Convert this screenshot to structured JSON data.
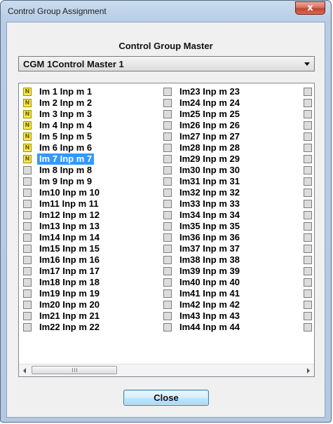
{
  "window": {
    "title": "Control Group Assignment",
    "close_glyph": "x"
  },
  "group_label": "Control Group Master",
  "combo": {
    "selected": "CGM 1Control Master 1"
  },
  "list": {
    "items": [
      {
        "label": "Im 1 Inp m  1",
        "checked": true,
        "selected": false
      },
      {
        "label": "Im 2 Inp m  2",
        "checked": true,
        "selected": false
      },
      {
        "label": "Im 3 Inp m  3",
        "checked": true,
        "selected": false
      },
      {
        "label": "Im 4 Inp m  4",
        "checked": true,
        "selected": false
      },
      {
        "label": "Im 5 Inp m  5",
        "checked": true,
        "selected": false
      },
      {
        "label": "Im 6 Inp m  6",
        "checked": true,
        "selected": false
      },
      {
        "label": "Im 7 Inp m  7",
        "checked": true,
        "selected": true
      },
      {
        "label": "Im 8 Inp m  8",
        "checked": false,
        "selected": false
      },
      {
        "label": "Im 9 Inp m  9",
        "checked": false,
        "selected": false
      },
      {
        "label": "Im10 Inp m 10",
        "checked": false,
        "selected": false
      },
      {
        "label": "Im11 Inp m 11",
        "checked": false,
        "selected": false
      },
      {
        "label": "Im12 Inp m 12",
        "checked": false,
        "selected": false
      },
      {
        "label": "Im13 Inp m 13",
        "checked": false,
        "selected": false
      },
      {
        "label": "Im14 Inp m 14",
        "checked": false,
        "selected": false
      },
      {
        "label": "Im15 Inp m 15",
        "checked": false,
        "selected": false
      },
      {
        "label": "Im16 Inp m 16",
        "checked": false,
        "selected": false
      },
      {
        "label": "Im17 Inp m 17",
        "checked": false,
        "selected": false
      },
      {
        "label": "Im18 Inp m 18",
        "checked": false,
        "selected": false
      },
      {
        "label": "Im19 Inp m 19",
        "checked": false,
        "selected": false
      },
      {
        "label": "Im20 Inp m 20",
        "checked": false,
        "selected": false
      },
      {
        "label": "Im21 Inp m 21",
        "checked": false,
        "selected": false
      },
      {
        "label": "Im22 Inp m 22",
        "checked": false,
        "selected": false
      },
      {
        "label": "Im23 Inp m 23",
        "checked": false,
        "selected": false
      },
      {
        "label": "Im24 Inp m 24",
        "checked": false,
        "selected": false
      },
      {
        "label": "Im25 Inp m 25",
        "checked": false,
        "selected": false
      },
      {
        "label": "Im26 Inp m 26",
        "checked": false,
        "selected": false
      },
      {
        "label": "Im27 Inp m 27",
        "checked": false,
        "selected": false
      },
      {
        "label": "Im28 Inp m 28",
        "checked": false,
        "selected": false
      },
      {
        "label": "Im29 Inp m 29",
        "checked": false,
        "selected": false
      },
      {
        "label": "Im30 Inp m 30",
        "checked": false,
        "selected": false
      },
      {
        "label": "Im31 Inp m 31",
        "checked": false,
        "selected": false
      },
      {
        "label": "Im32 Inp m 32",
        "checked": false,
        "selected": false
      },
      {
        "label": "Im33 Inp m 33",
        "checked": false,
        "selected": false
      },
      {
        "label": "Im34 Inp m 34",
        "checked": false,
        "selected": false
      },
      {
        "label": "Im35 Inp m 35",
        "checked": false,
        "selected": false
      },
      {
        "label": "Im36 Inp m 36",
        "checked": false,
        "selected": false
      },
      {
        "label": "Im37 Inp m 37",
        "checked": false,
        "selected": false
      },
      {
        "label": "Im38 Inp m 38",
        "checked": false,
        "selected": false
      },
      {
        "label": "Im39 Inp m 39",
        "checked": false,
        "selected": false
      },
      {
        "label": "Im40 Inp m 40",
        "checked": false,
        "selected": false
      },
      {
        "label": "Im41 Inp m 41",
        "checked": false,
        "selected": false
      },
      {
        "label": "Im42 Inp m 42",
        "checked": false,
        "selected": false
      },
      {
        "label": "Im43 Inp m 43",
        "checked": false,
        "selected": false
      },
      {
        "label": "Im44 Inp m 44",
        "checked": false,
        "selected": false
      }
    ],
    "checked_mark": "N",
    "scroll_grip": "III"
  },
  "close_button": {
    "label": "Close"
  },
  "colors": {
    "selection": "#3399ff",
    "checked_fill": "#f5e94a",
    "unchecked_fill": "#dcdcdc"
  }
}
